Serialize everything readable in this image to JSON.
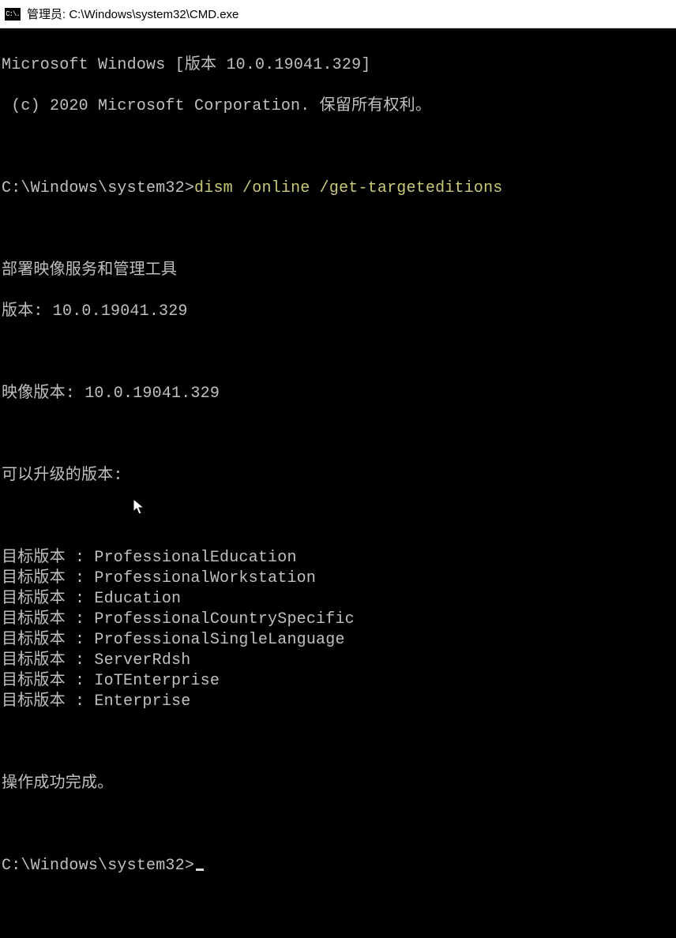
{
  "window": {
    "icon_label": "C:\\.",
    "title": "管理员: C:\\Windows\\system32\\CMD.exe"
  },
  "terminal": {
    "header1": "Microsoft Windows [版本 10.0.19041.329]",
    "header2": " (c) 2020 Microsoft Corporation. 保留所有权利。",
    "prompt1_path": "C:\\Windows\\system32>",
    "prompt1_cmd": "dism /online /get-targeteditions",
    "tool_name": "部署映像服务和管理工具",
    "tool_version": "版本: 10.0.19041.329",
    "image_version": "映像版本: 10.0.19041.329",
    "upgradable_header": "可以升级的版本:",
    "edition_label": "目标版本 : ",
    "editions": [
      "ProfessionalEducation",
      "ProfessionalWorkstation",
      "Education",
      "ProfessionalCountrySpecific",
      "ProfessionalSingleLanguage",
      "ServerRdsh",
      "IoTEnterprise",
      "Enterprise"
    ],
    "success": "操作成功完成。",
    "prompt2_path": "C:\\Windows\\system32>"
  }
}
